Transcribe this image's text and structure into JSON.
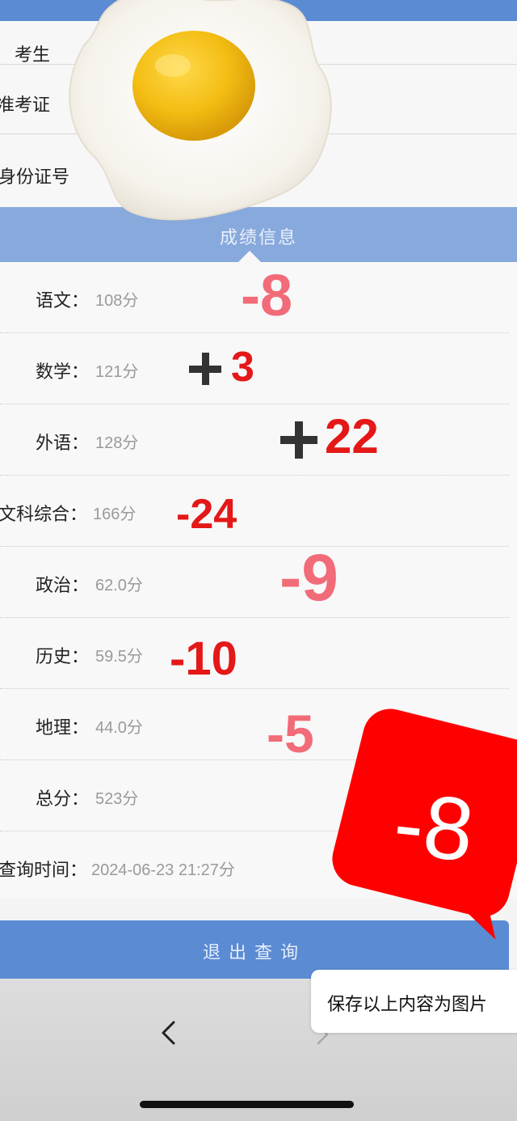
{
  "header": {
    "banner_fragment": "",
    "score_section_title": "成绩信息"
  },
  "info": {
    "rows": [
      {
        "label": "考生"
      },
      {
        "label": "准考证"
      },
      {
        "label": "身份证号"
      }
    ]
  },
  "scores": [
    {
      "label": "语文：",
      "value": "108分"
    },
    {
      "label": "数学：",
      "value": "121分"
    },
    {
      "label": "外语：",
      "value": "128分"
    },
    {
      "label": "文科综合：",
      "value": "166分"
    },
    {
      "label": "政治：",
      "value": "62.0分"
    },
    {
      "label": "历史：",
      "value": "59.5分"
    },
    {
      "label": "地理：",
      "value": "44.0分"
    },
    {
      "label": "总分：",
      "value": "523分"
    },
    {
      "label": "查询时间：",
      "value": "2024-06-23 21:27分"
    }
  ],
  "deltas": {
    "chinese": "-8",
    "math": "3",
    "foreign": "22",
    "liberal_arts": "-24",
    "politics": "-9",
    "history": "-10",
    "geography": "-5"
  },
  "badge": {
    "text": "-8"
  },
  "exit_button": {
    "label": "退出查询"
  },
  "save_tooltip": {
    "text": "保存以上内容为图片"
  },
  "colors": {
    "primary_blue": "#5b8bd3",
    "header_blue": "#88a9dc",
    "delta_pink": "#f26b78",
    "delta_red": "#e41818",
    "badge_red": "#ff0000"
  },
  "icons": [
    "fried-egg-sticker",
    "back-chevron-icon",
    "forward-chevron-icon"
  ]
}
